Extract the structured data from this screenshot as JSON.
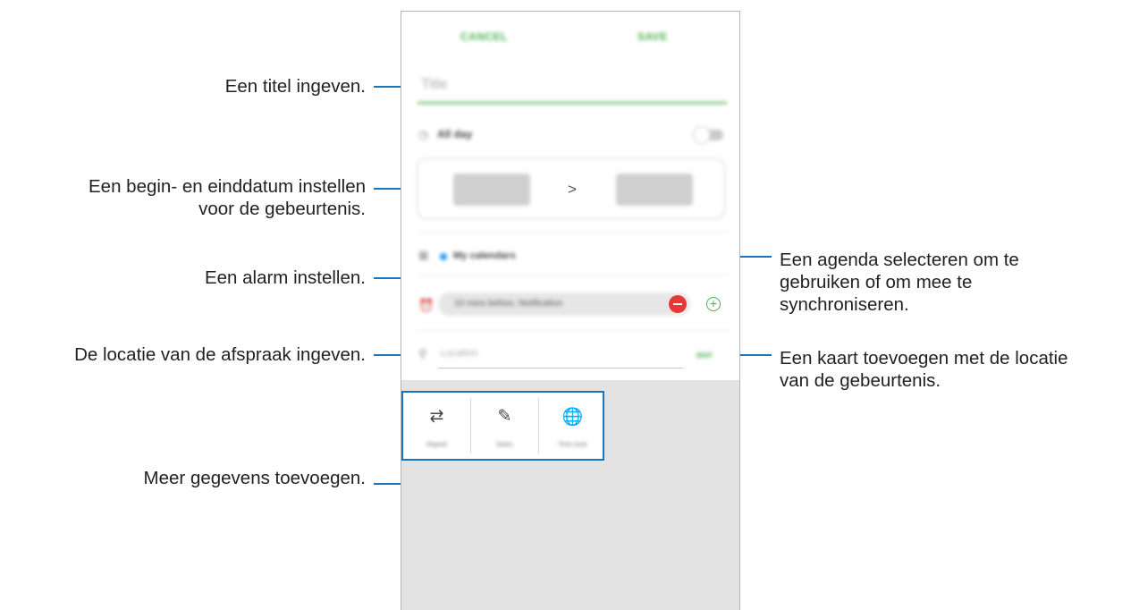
{
  "callouts": {
    "title": "Een titel ingeven.",
    "date_line1": "Een begin- en einddatum instellen",
    "date_line2": "voor de gebeurtenis.",
    "alarm": "Een alarm instellen.",
    "location": "De locatie van de afspraak ingeven.",
    "more": "Meer gegevens toevoegen.",
    "calendar_line1": "Een agenda selecteren om te",
    "calendar_line2": "gebruiken of om mee te",
    "calendar_line3": "synchroniseren.",
    "map_line1": "Een kaart toevoegen met de locatie",
    "map_line2": "van de gebeurtenis."
  },
  "form": {
    "cancel_label": "CANCEL",
    "save_label": "SAVE",
    "title_placeholder": "Title",
    "all_day_label": "All day",
    "date_arrow": ">",
    "calendar_label": "My calendars",
    "alarm_value": "10 mins before, Notification",
    "location_placeholder": "Location",
    "map_label": "MAP"
  },
  "options": [
    {
      "label": "Repeat",
      "icon": "repeat-icon"
    },
    {
      "label": "Notes",
      "icon": "notes-icon"
    },
    {
      "label": "Time zone",
      "icon": "globe-icon"
    }
  ],
  "colors": {
    "accent_green": "#4caf50",
    "callout_line": "#1b75bc",
    "calendar_dot": "#2196f3"
  }
}
